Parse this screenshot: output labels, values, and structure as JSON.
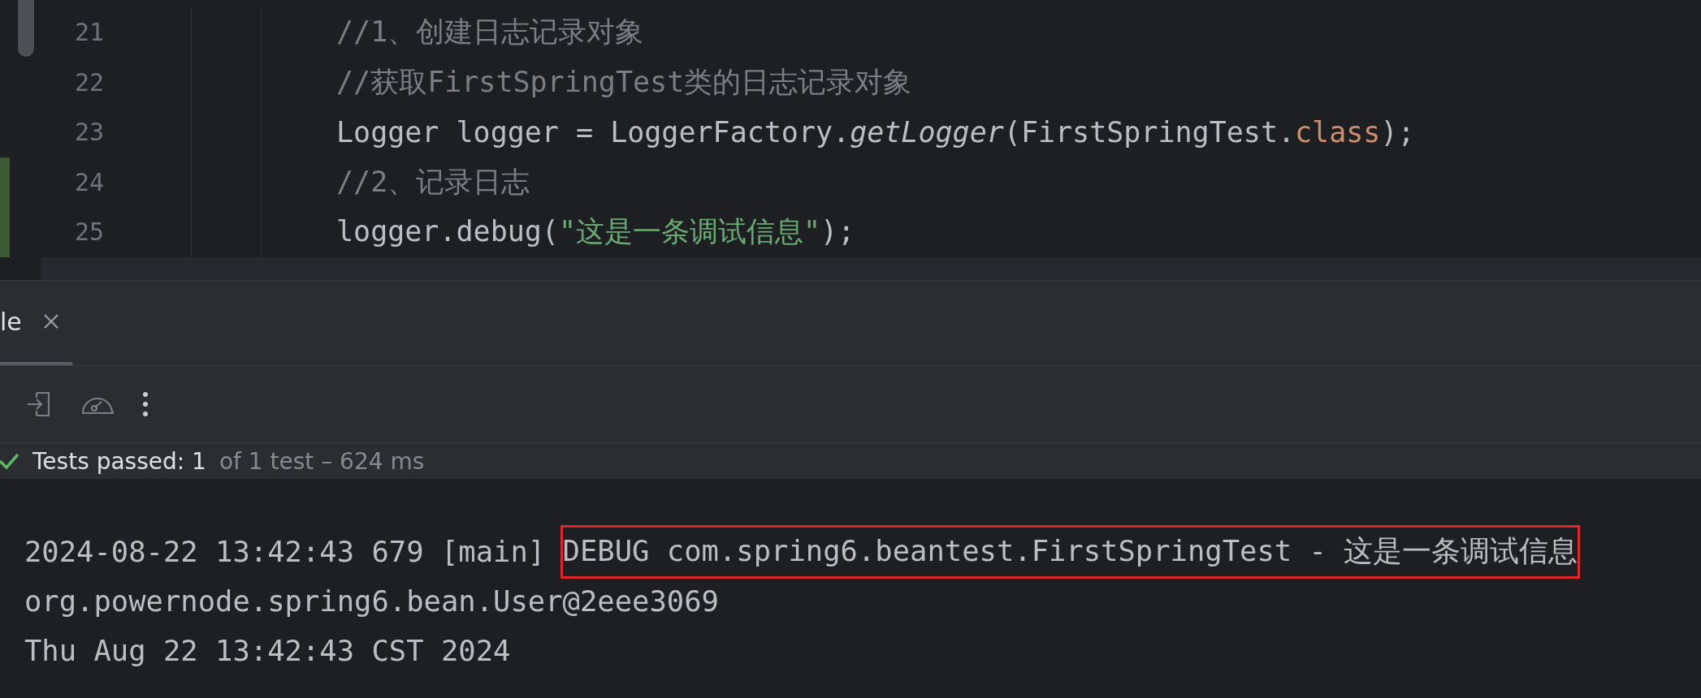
{
  "editor": {
    "lines": [
      {
        "number": "21",
        "changed": false,
        "tokens": [
          {
            "kind": "comment",
            "text": "//1、创建日志记录对象"
          }
        ]
      },
      {
        "number": "22",
        "changed": false,
        "tokens": [
          {
            "kind": "comment",
            "text": "//获取FirstSpringTest类的日志记录对象"
          }
        ]
      },
      {
        "number": "23",
        "changed": false,
        "tokens": [
          {
            "kind": "plain",
            "text": "Logger logger = LoggerFactory."
          },
          {
            "kind": "method",
            "text": "getLogger"
          },
          {
            "kind": "plain",
            "text": "(FirstSpringTest."
          },
          {
            "kind": "keyword",
            "text": "class"
          },
          {
            "kind": "plain",
            "text": ");"
          }
        ]
      },
      {
        "number": "24",
        "changed": true,
        "tokens": [
          {
            "kind": "comment",
            "text": "//2、记录日志"
          }
        ]
      },
      {
        "number": "25",
        "changed": true,
        "tokens": [
          {
            "kind": "plain",
            "text": "logger.debug("
          },
          {
            "kind": "string",
            "text": "\"这是一条调试信息\""
          },
          {
            "kind": "plain",
            "text": ");"
          }
        ]
      }
    ]
  },
  "tool_window": {
    "tabs": [
      {
        "label": "le",
        "selected": true,
        "closable": true
      }
    ],
    "toolbar": [
      {
        "kind": "import"
      },
      {
        "kind": "gauge"
      },
      {
        "kind": "more"
      }
    ],
    "status": {
      "passed": true,
      "label": "Tests passed: 1",
      "detail": "of 1 test – 624 ms"
    }
  },
  "console": {
    "lines": [
      {
        "segments": [
          {
            "text": "2024-08-22 13:42:43 679 [main] ",
            "highlighted": false
          },
          {
            "text": "DEBUG com.spring6.beantest.FirstSpringTest - 这是一条调试信息",
            "highlighted": true
          }
        ]
      },
      {
        "segments": [
          {
            "text": "org.powernode.spring6.bean.User@2eee3069",
            "highlighted": false
          }
        ]
      },
      {
        "segments": [
          {
            "text": "Thu Aug 22 13:42:43 CST 2024",
            "highlighted": false
          }
        ]
      }
    ]
  }
}
